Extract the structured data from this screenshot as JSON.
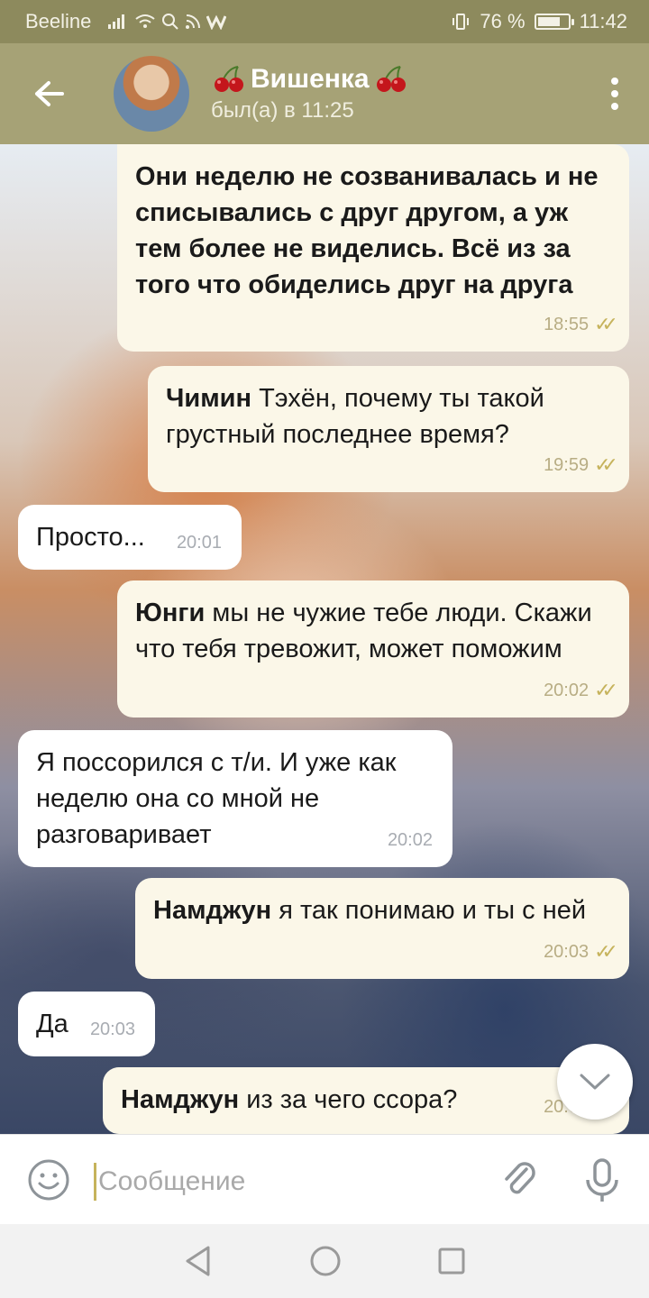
{
  "status_bar": {
    "carrier": "Beeline",
    "battery_text": "76 %",
    "battery_level": 0.76,
    "time": "11:42"
  },
  "header": {
    "name": "Вишенка",
    "status": "был(а) в 11:25"
  },
  "messages": [
    {
      "side": "out",
      "sender": "",
      "text": "Они неделю не созванивалась и не списывались с друг другом, а уж тем более не виделись. Всё из за того что обиделись друг на друга",
      "time": "18:55"
    },
    {
      "side": "out",
      "sender": "Чимин",
      "text": "Тэхён, почему ты такой грустный последнее время?",
      "time": "19:59"
    },
    {
      "side": "in",
      "sender": "",
      "text": "Просто...",
      "time": "20:01"
    },
    {
      "side": "out",
      "sender": "Юнги",
      "text": "мы не чужие тебе люди. Скажи что тебя тревожит, может поможим",
      "time": "20:02"
    },
    {
      "side": "in",
      "sender": "",
      "text": "Я поссорился с т/и. И уже как неделю она со мной не разговаривает",
      "time": "20:02"
    },
    {
      "side": "out",
      "sender": "Намджун",
      "text": "я так понимаю и ты с ней",
      "time": "20:03"
    },
    {
      "side": "in",
      "sender": "",
      "text": "Да",
      "time": "20:03"
    },
    {
      "side": "out",
      "sender": "Намджун",
      "text": "из за чего ссора?",
      "time": "20:03"
    }
  ],
  "input": {
    "placeholder": "Сообщение"
  },
  "icons": {
    "back": "arrow-left-icon",
    "menu": "more-vertical-icon",
    "emoji": "smile-icon",
    "attach": "paperclip-icon",
    "mic": "microphone-icon",
    "scroll": "chevron-down-icon",
    "nav": [
      "nav-back-icon",
      "nav-home-icon",
      "nav-recents-icon"
    ]
  },
  "colors": {
    "header": "#a6a276",
    "status_bar": "#8d8a5d",
    "outgoing_bubble": "#fbf7e8",
    "incoming_bubble": "#ffffff",
    "read_ticks": "#c6b35c"
  }
}
